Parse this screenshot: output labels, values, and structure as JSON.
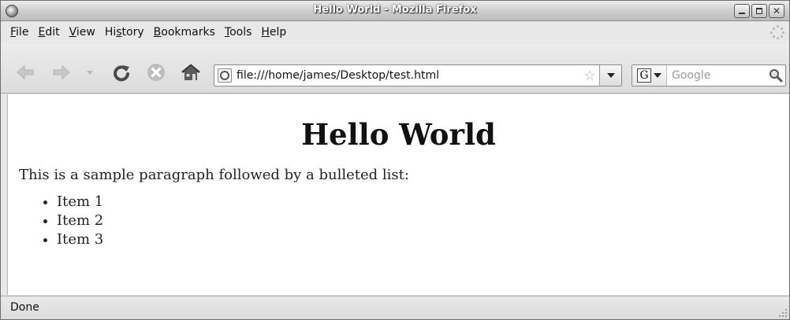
{
  "window": {
    "title": "Hello World - Mozilla Firefox",
    "controls": {
      "minimize": "minimize",
      "maximize": "maximize",
      "close": "✕"
    }
  },
  "menubar": {
    "items": [
      {
        "pre": "",
        "key": "F",
        "post": "ile"
      },
      {
        "pre": "",
        "key": "E",
        "post": "dit"
      },
      {
        "pre": "",
        "key": "V",
        "post": "iew"
      },
      {
        "pre": "Hi",
        "key": "s",
        "post": "tory"
      },
      {
        "pre": "",
        "key": "B",
        "post": "ookmarks"
      },
      {
        "pre": "",
        "key": "T",
        "post": "ools"
      },
      {
        "pre": "",
        "key": "H",
        "post": "elp"
      }
    ]
  },
  "toolbar": {
    "url": "file:///home/james/Desktop/test.html",
    "search_engine_letter": "G",
    "search_placeholder": "Google",
    "icons": [
      "back-arrow-icon",
      "forward-arrow-icon",
      "history-dropdown-icon",
      "reload-icon",
      "stop-icon",
      "home-icon",
      "bookmark-star-icon",
      "magnifier-icon"
    ]
  },
  "page": {
    "heading": "Hello World",
    "paragraph": "This is a sample paragraph followed by a bulleted list:",
    "list": [
      "Item 1",
      "Item 2",
      "Item 3"
    ]
  },
  "status": {
    "text": "Done"
  },
  "colors": {
    "chrome": "#e8e8e8",
    "content_bg": "#ffffff",
    "title_text": "#ffffff"
  }
}
